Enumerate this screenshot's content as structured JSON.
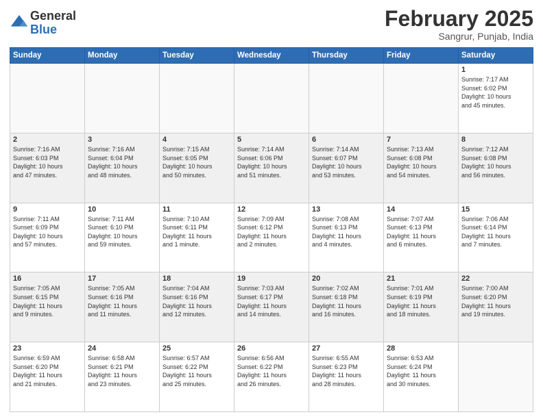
{
  "header": {
    "logo_line1": "General",
    "logo_line2": "Blue",
    "month": "February 2025",
    "location": "Sangrur, Punjab, India"
  },
  "weekdays": [
    "Sunday",
    "Monday",
    "Tuesday",
    "Wednesday",
    "Thursday",
    "Friday",
    "Saturday"
  ],
  "weeks": [
    [
      {
        "day": "",
        "info": ""
      },
      {
        "day": "",
        "info": ""
      },
      {
        "day": "",
        "info": ""
      },
      {
        "day": "",
        "info": ""
      },
      {
        "day": "",
        "info": ""
      },
      {
        "day": "",
        "info": ""
      },
      {
        "day": "1",
        "info": "Sunrise: 7:17 AM\nSunset: 6:02 PM\nDaylight: 10 hours\nand 45 minutes."
      }
    ],
    [
      {
        "day": "2",
        "info": "Sunrise: 7:16 AM\nSunset: 6:03 PM\nDaylight: 10 hours\nand 47 minutes."
      },
      {
        "day": "3",
        "info": "Sunrise: 7:16 AM\nSunset: 6:04 PM\nDaylight: 10 hours\nand 48 minutes."
      },
      {
        "day": "4",
        "info": "Sunrise: 7:15 AM\nSunset: 6:05 PM\nDaylight: 10 hours\nand 50 minutes."
      },
      {
        "day": "5",
        "info": "Sunrise: 7:14 AM\nSunset: 6:06 PM\nDaylight: 10 hours\nand 51 minutes."
      },
      {
        "day": "6",
        "info": "Sunrise: 7:14 AM\nSunset: 6:07 PM\nDaylight: 10 hours\nand 53 minutes."
      },
      {
        "day": "7",
        "info": "Sunrise: 7:13 AM\nSunset: 6:08 PM\nDaylight: 10 hours\nand 54 minutes."
      },
      {
        "day": "8",
        "info": "Sunrise: 7:12 AM\nSunset: 6:08 PM\nDaylight: 10 hours\nand 56 minutes."
      }
    ],
    [
      {
        "day": "9",
        "info": "Sunrise: 7:11 AM\nSunset: 6:09 PM\nDaylight: 10 hours\nand 57 minutes."
      },
      {
        "day": "10",
        "info": "Sunrise: 7:11 AM\nSunset: 6:10 PM\nDaylight: 10 hours\nand 59 minutes."
      },
      {
        "day": "11",
        "info": "Sunrise: 7:10 AM\nSunset: 6:11 PM\nDaylight: 11 hours\nand 1 minute."
      },
      {
        "day": "12",
        "info": "Sunrise: 7:09 AM\nSunset: 6:12 PM\nDaylight: 11 hours\nand 2 minutes."
      },
      {
        "day": "13",
        "info": "Sunrise: 7:08 AM\nSunset: 6:13 PM\nDaylight: 11 hours\nand 4 minutes."
      },
      {
        "day": "14",
        "info": "Sunrise: 7:07 AM\nSunset: 6:13 PM\nDaylight: 11 hours\nand 6 minutes."
      },
      {
        "day": "15",
        "info": "Sunrise: 7:06 AM\nSunset: 6:14 PM\nDaylight: 11 hours\nand 7 minutes."
      }
    ],
    [
      {
        "day": "16",
        "info": "Sunrise: 7:05 AM\nSunset: 6:15 PM\nDaylight: 11 hours\nand 9 minutes."
      },
      {
        "day": "17",
        "info": "Sunrise: 7:05 AM\nSunset: 6:16 PM\nDaylight: 11 hours\nand 11 minutes."
      },
      {
        "day": "18",
        "info": "Sunrise: 7:04 AM\nSunset: 6:16 PM\nDaylight: 11 hours\nand 12 minutes."
      },
      {
        "day": "19",
        "info": "Sunrise: 7:03 AM\nSunset: 6:17 PM\nDaylight: 11 hours\nand 14 minutes."
      },
      {
        "day": "20",
        "info": "Sunrise: 7:02 AM\nSunset: 6:18 PM\nDaylight: 11 hours\nand 16 minutes."
      },
      {
        "day": "21",
        "info": "Sunrise: 7:01 AM\nSunset: 6:19 PM\nDaylight: 11 hours\nand 18 minutes."
      },
      {
        "day": "22",
        "info": "Sunrise: 7:00 AM\nSunset: 6:20 PM\nDaylight: 11 hours\nand 19 minutes."
      }
    ],
    [
      {
        "day": "23",
        "info": "Sunrise: 6:59 AM\nSunset: 6:20 PM\nDaylight: 11 hours\nand 21 minutes."
      },
      {
        "day": "24",
        "info": "Sunrise: 6:58 AM\nSunset: 6:21 PM\nDaylight: 11 hours\nand 23 minutes."
      },
      {
        "day": "25",
        "info": "Sunrise: 6:57 AM\nSunset: 6:22 PM\nDaylight: 11 hours\nand 25 minutes."
      },
      {
        "day": "26",
        "info": "Sunrise: 6:56 AM\nSunset: 6:22 PM\nDaylight: 11 hours\nand 26 minutes."
      },
      {
        "day": "27",
        "info": "Sunrise: 6:55 AM\nSunset: 6:23 PM\nDaylight: 11 hours\nand 28 minutes."
      },
      {
        "day": "28",
        "info": "Sunrise: 6:53 AM\nSunset: 6:24 PM\nDaylight: 11 hours\nand 30 minutes."
      },
      {
        "day": "",
        "info": ""
      }
    ]
  ]
}
